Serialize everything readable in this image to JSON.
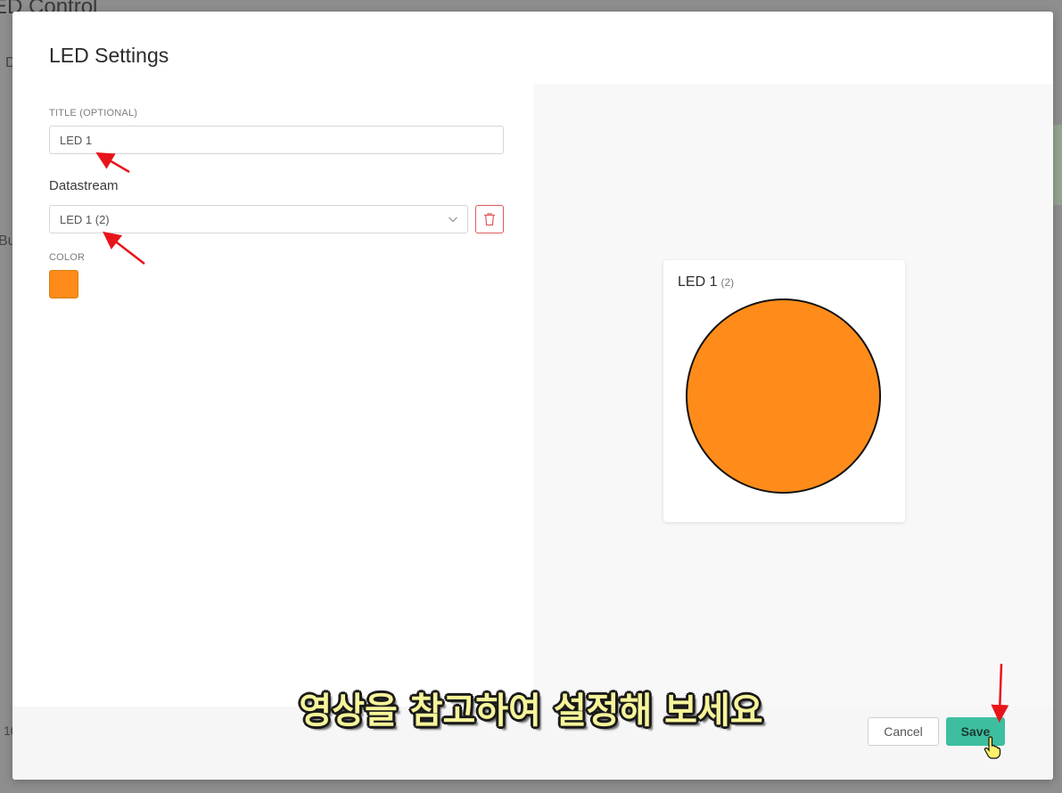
{
  "background": {
    "title": "ED Control",
    "frag_1": "D",
    "frag_2": "Bu",
    "frag_3": "10"
  },
  "modal": {
    "title": "LED Settings",
    "title_field": {
      "label": "TITLE (OPTIONAL)",
      "value": "LED 1"
    },
    "datastream": {
      "label": "Datastream",
      "selected": "LED 1 (2)"
    },
    "color": {
      "label": "COLOR",
      "value": "#ff8c1a"
    }
  },
  "preview": {
    "title": "LED 1",
    "pin": "(2)",
    "led_color": "#ff8c1a"
  },
  "footer": {
    "cancel_label": "Cancel",
    "save_label": "Save",
    "save_color": "#3dbf9f"
  },
  "caption": "영상을 참고하여 설정해 보세요",
  "icons": {
    "select_arrow": "chevron-down-icon",
    "delete": "trash-icon",
    "pointer": "hand-pointer-icon"
  }
}
